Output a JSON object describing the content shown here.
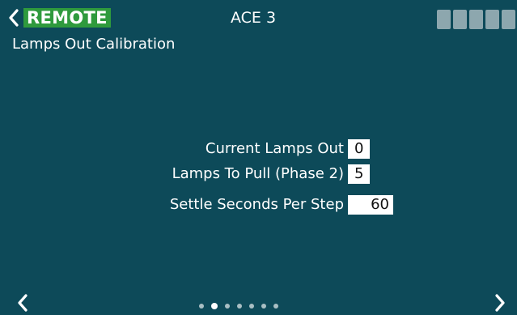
{
  "header": {
    "mode_badge": "REMOTE",
    "device_name": "ACE 3",
    "signal_bars": 5
  },
  "page": {
    "title": "Lamps Out Calibration"
  },
  "fields": [
    {
      "label": "Current Lamps Out",
      "value": "0"
    },
    {
      "label": "Lamps To Pull (Phase 2)",
      "value": "5"
    },
    {
      "label": "Settle Seconds Per Step",
      "value": "60"
    }
  ],
  "pagination": {
    "total_pages": 7,
    "current_page": 2
  },
  "icons": {
    "back": "chevron-left-icon",
    "prev": "chevron-left-icon",
    "next": "chevron-right-icon",
    "signal": "signal-bars-icon"
  },
  "colors": {
    "background": "#0d4a59",
    "remote_badge": "#2f9a3d",
    "signal_bars": "#8da7ae"
  }
}
